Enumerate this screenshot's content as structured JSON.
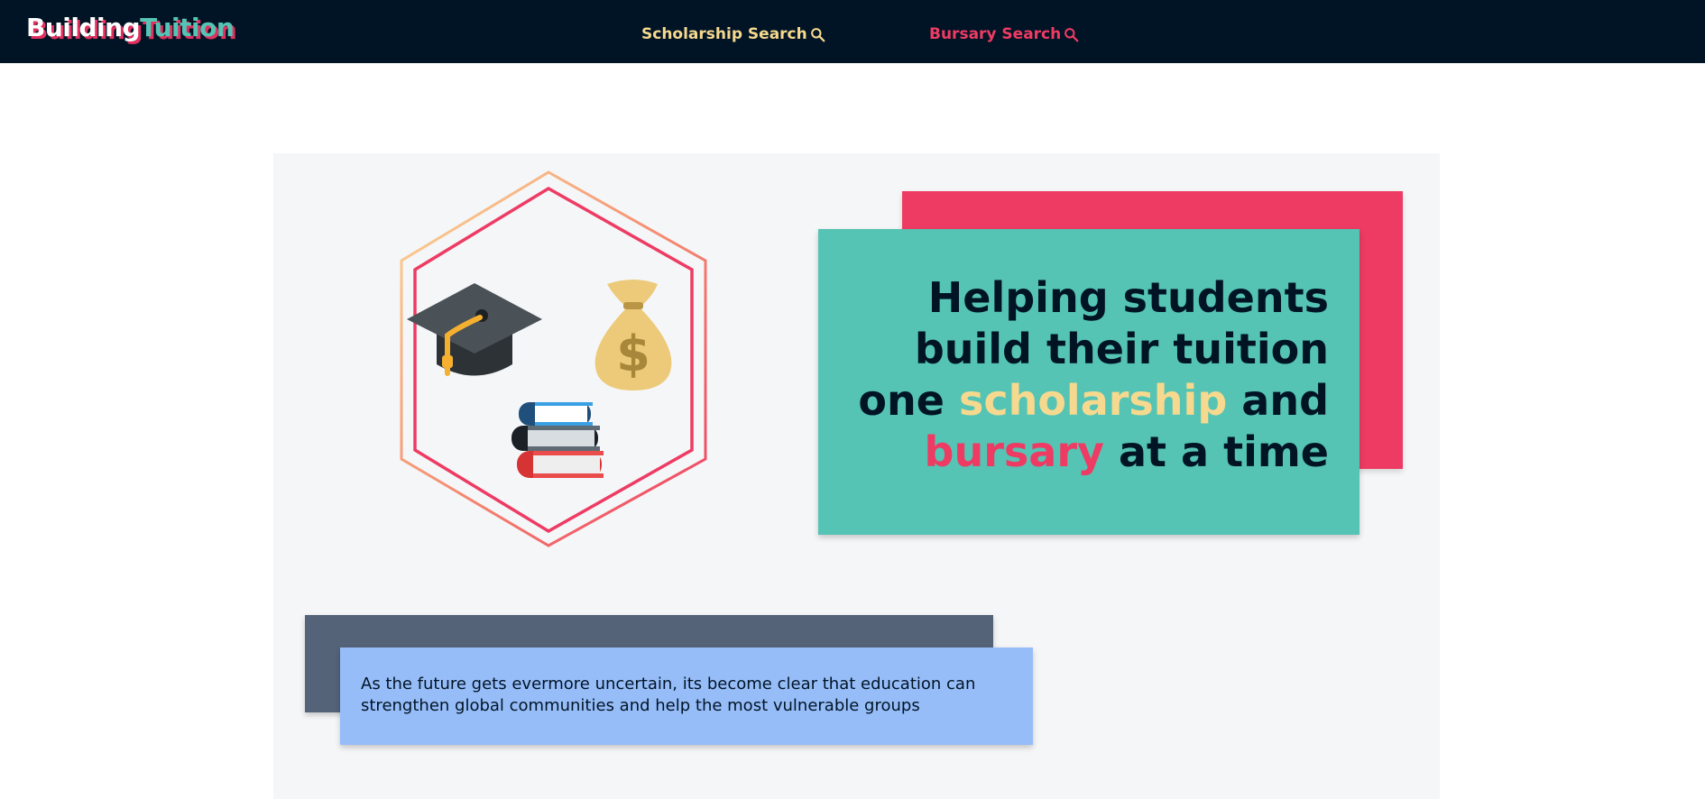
{
  "header": {
    "logo_part1": "Building",
    "logo_part2": "Tuition",
    "nav": [
      {
        "label": "Scholarship Search",
        "icon": "search-icon"
      },
      {
        "label": "Bursary Search",
        "icon": "search-icon"
      }
    ]
  },
  "hero": {
    "headline_part1": "Helping students build their tuition one",
    "headline_highlight1": "scholarship",
    "headline_part2": "and",
    "headline_highlight2": "bursary",
    "headline_part3": "at a time",
    "illustrations": [
      "graduation-cap-icon",
      "money-bag-icon",
      "book-stack-icon"
    ]
  },
  "intro": {
    "text": "As the future gets evermore uncertain, its become clear that education can strengthen global communities and help the most vulnerable groups"
  },
  "colors": {
    "navy": "#011425",
    "teal": "#55c4b4",
    "pink": "#ee3b63",
    "yellow": "#f6d98e",
    "slate": "#546378",
    "blue": "#97bdf9",
    "panel": "#f5f6f8"
  }
}
